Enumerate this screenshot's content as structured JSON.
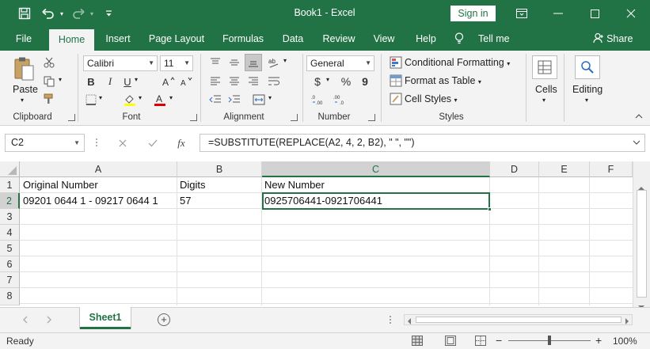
{
  "window": {
    "title": "Book1  -  Excel",
    "signin_label": "Sign in",
    "quick_access": [
      "save-icon",
      "undo-icon",
      "redo-icon",
      "customize-qat-icon"
    ],
    "controls": [
      "ribbon-display-options-icon",
      "minimize-icon",
      "maximize-icon",
      "close-icon"
    ]
  },
  "tabs": {
    "items": [
      "File",
      "Home",
      "Insert",
      "Page Layout",
      "Formulas",
      "Data",
      "Review",
      "View",
      "Help"
    ],
    "active": "Home",
    "tell_me": "Tell me",
    "share": "Share"
  },
  "ribbon": {
    "clipboard": {
      "label": "Clipboard",
      "paste": "Paste"
    },
    "font": {
      "label": "Font",
      "name": "Calibri",
      "size": "11",
      "bold": "B",
      "italic": "I",
      "underline": "U"
    },
    "alignment": {
      "label": "Alignment"
    },
    "number": {
      "label": "Number",
      "format": "General",
      "currency": "$",
      "percent": "%",
      "comma": "9"
    },
    "styles": {
      "label": "Styles",
      "conditional": "Conditional Formatting",
      "format_table": "Format as Table",
      "cell_styles": "Cell Styles"
    },
    "cells": {
      "label": "Cells"
    },
    "editing": {
      "label": "Editing"
    }
  },
  "formula_bar": {
    "name_box": "C2",
    "formula": "=SUBSTITUTE(REPLACE(A2, 4, 2, B2), \" \", \"\")",
    "fx": "fx"
  },
  "grid": {
    "columns": [
      "A",
      "B",
      "C",
      "D",
      "E",
      "F"
    ],
    "rows": [
      "1",
      "2",
      "3",
      "4",
      "5",
      "6",
      "7",
      "8"
    ],
    "selected_cell": "C2",
    "cells": {
      "A1": "Original Number",
      "B1": "Digits",
      "C1": "New Number",
      "A2": "09201 0644 1 - 09217 0644 1",
      "B2": "57",
      "C2": "0925706441-0921706441"
    }
  },
  "sheets": {
    "tabs": [
      "Sheet1"
    ],
    "active": "Sheet1"
  },
  "status": {
    "text": "Ready",
    "zoom": "100%",
    "minus": "−",
    "plus": "+"
  },
  "colors": {
    "accent": "#217346",
    "ribbon_bg": "#f3f3f3",
    "header_bg": "#f0f0f0",
    "selected_header_bg": "#d2d2d2"
  }
}
